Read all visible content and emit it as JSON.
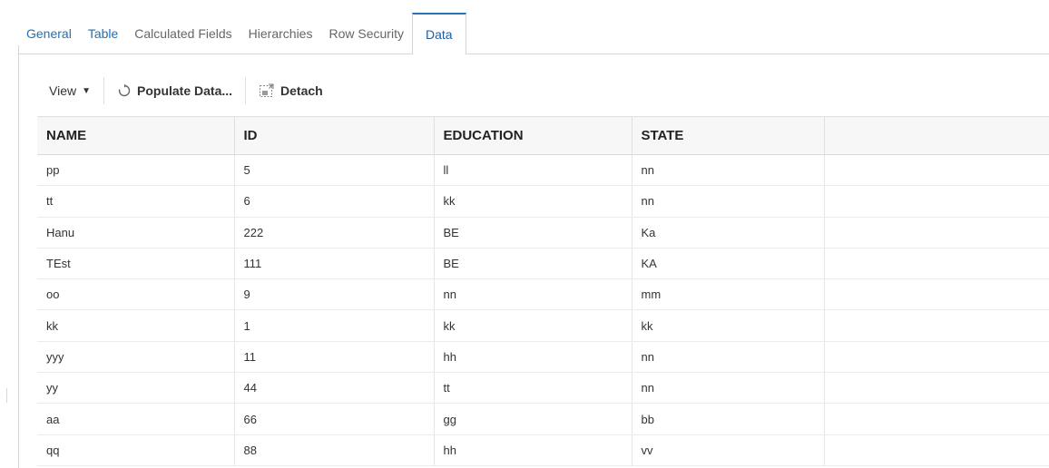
{
  "tabs": [
    {
      "label": "General",
      "active": false
    },
    {
      "label": "Table",
      "active": false
    },
    {
      "label": "Calculated Fields",
      "active": false
    },
    {
      "label": "Hierarchies",
      "active": false
    },
    {
      "label": "Row Security",
      "active": false
    },
    {
      "label": "Data",
      "active": true
    }
  ],
  "toolbar": {
    "view_label": "View",
    "populate_label": "Populate Data...",
    "detach_label": "Detach"
  },
  "table": {
    "columns": [
      "NAME",
      "ID",
      "EDUCATION",
      "STATE",
      ""
    ],
    "rows": [
      [
        "pp",
        "5",
        "ll",
        "nn"
      ],
      [
        "tt",
        "6",
        "kk",
        "nn"
      ],
      [
        "Hanu",
        "222",
        "BE",
        "Ka"
      ],
      [
        "TEst",
        "111",
        "BE",
        "KA"
      ],
      [
        "oo",
        "9",
        "nn",
        "mm"
      ],
      [
        "kk",
        "1",
        "kk",
        "kk"
      ],
      [
        "yyy",
        "11",
        "hh",
        "nn"
      ],
      [
        "yy",
        "44",
        "tt",
        "nn"
      ],
      [
        "aa",
        "66",
        "gg",
        "bb"
      ],
      [
        "qq",
        "88",
        "hh",
        "vv"
      ]
    ]
  },
  "colors": {
    "link": "#1f6fb6",
    "active_tab_border": "#2b73b5",
    "header_bg": "#f7f7f7"
  }
}
